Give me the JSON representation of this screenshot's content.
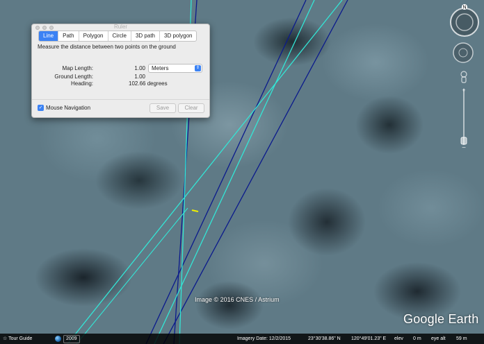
{
  "dialog": {
    "title": "Ruler",
    "tabs": [
      "Line",
      "Path",
      "Polygon",
      "Circle",
      "3D path",
      "3D polygon"
    ],
    "active_tab": "Line",
    "instruction": "Measure the distance between two points on the ground",
    "map_length_label": "Map Length:",
    "map_length_value": "1.00",
    "unit_selected": "Meters",
    "ground_length_label": "Ground Length:",
    "ground_length_value": "1.00",
    "heading_label": "Heading:",
    "heading_value": "102.66 degrees",
    "mouse_nav_label": "Mouse Navigation",
    "mouse_nav_checked": true,
    "save_label": "Save",
    "clear_label": "Clear",
    "accent": "#3b82f4"
  },
  "nav": {
    "north_label": "N"
  },
  "overlay": {
    "copyright": "Image © 2016 CNES / Astrium",
    "logo": "Google Earth"
  },
  "status": {
    "tour_guide": "Tour Guide",
    "year": "2009",
    "imagery_date": "Imagery Date: 12/2/2015",
    "latitude": "23°30'38.86\" N",
    "longitude": "120°49'01.23\" E",
    "elev_label": "elev",
    "elev_value": "0 m",
    "eye_alt_label": "eye alt",
    "eye_alt_value": "59 m"
  },
  "colors": {
    "cyan_line": "#33e6d6",
    "navy_line": "#0b1a8c",
    "measure_line": "#f0f000"
  }
}
